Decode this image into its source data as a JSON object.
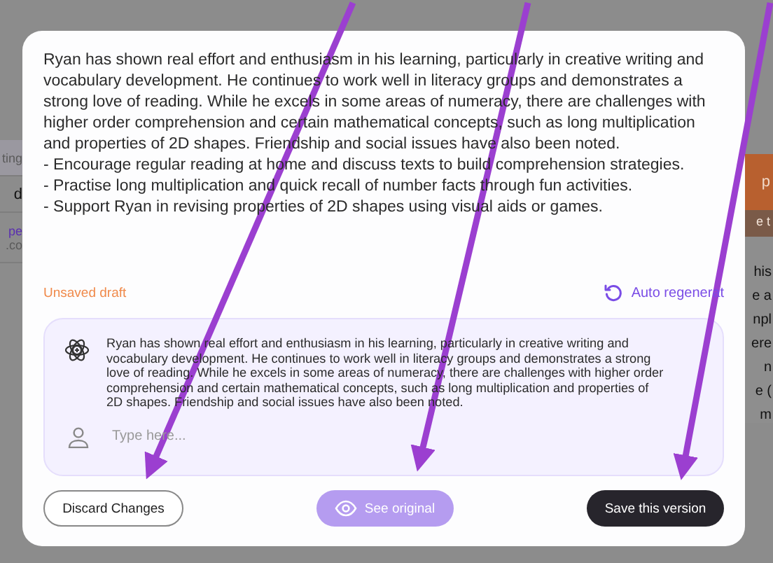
{
  "background": {
    "left_fragments": [
      {
        "text": "ting",
        "kind": "muted"
      },
      {
        "text": "d",
        "kind": "plain"
      },
      {
        "text": "pe",
        "kind": "link"
      },
      {
        "text": ".co",
        "kind": "muted"
      }
    ],
    "right_banner": {
      "text": "p",
      "subtext": "e t"
    },
    "right_fragments": [
      "his",
      "e a",
      "npl",
      "ere",
      "n",
      "e (",
      "m"
    ]
  },
  "modal": {
    "paragraph": "Ryan has shown real effort and enthusiasm in his learning, particularly in creative writing and vocabulary development. He continues to work well in literacy groups and demonstrates a strong love of reading. While he excels in some areas of numeracy, there are challenges with higher order comprehension and certain mathematical concepts, such as long multiplication and properties of 2D shapes. Friendship and social issues have also been noted.",
    "bullets": [
      "- Encourage regular reading at home and discuss texts to build comprehension strategies.",
      "- Practise long multiplication and quick recall of number facts through fun activities.",
      "- Support Ryan in revising properties of 2D shapes using visual aids or games."
    ],
    "status": "Unsaved draft",
    "auto_regenerate": "Auto regenerat",
    "chat": {
      "message": "Ryan has shown real effort and enthusiasm in his learning, particularly in creative writing and vocabulary development. He continues to work well in literacy groups and demonstrates a strong love of reading. While he excels in some areas of numeracy, there are challenges with higher order comprehension and certain mathematical concepts, such as long multiplication and properties of 2D shapes. Friendship and social issues have also been noted.",
      "input": {
        "placeholder": "Type here..."
      }
    },
    "buttons": [
      {
        "label": "Discard Changes",
        "kind": "outline"
      },
      {
        "label": "See original",
        "kind": "accent"
      },
      {
        "label": "Save this version",
        "kind": "dark"
      }
    ]
  }
}
